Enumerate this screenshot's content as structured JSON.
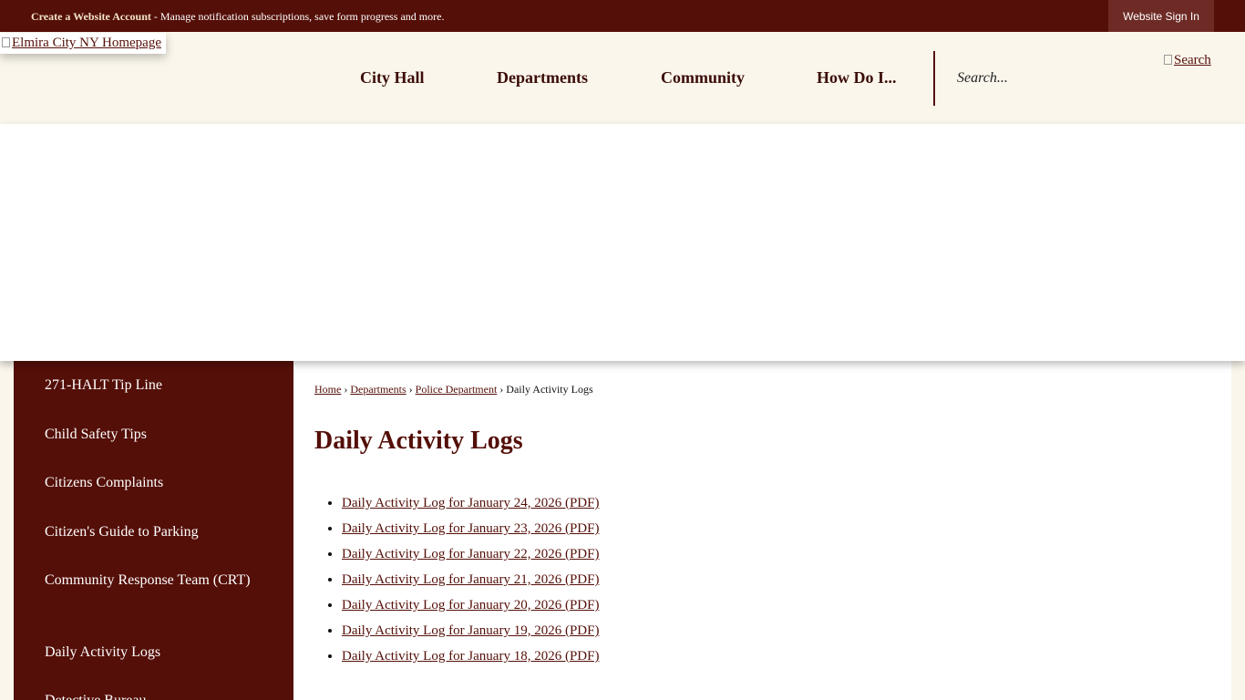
{
  "topbar": {
    "account_link": "Create a Website Account",
    "account_desc": " - Manage notification subscriptions, save form progress and more.",
    "signin_label": "Website Sign In"
  },
  "header": {
    "logo_alt": "Elmira City NY Homepage",
    "nav": [
      "City Hall",
      "Departments",
      "Community",
      "How Do I..."
    ],
    "search_placeholder": "Search...",
    "search_button_alt": "Search"
  },
  "sidebar": {
    "items": [
      "271-HALT Tip Line",
      "Child Safety Tips",
      "Citizens Complaints",
      "Citizen's Guide to Parking",
      "Community Response Team (CRT)",
      "Daily Activity Logs",
      "Detective Bureau"
    ]
  },
  "breadcrumb": {
    "items": [
      "Home",
      "Departments",
      "Police Department"
    ],
    "separator": "›",
    "current": "Daily Activity Logs"
  },
  "main": {
    "title": "Daily Activity Logs",
    "logs": [
      "Daily Activity Log for January 24, 2026 (PDF)",
      "Daily Activity Log for January 23, 2026 (PDF)",
      "Daily Activity Log for January 22, 2026 (PDF)",
      "Daily Activity Log for January 21, 2026 (PDF)",
      "Daily Activity Log for January 20, 2026 (PDF)",
      "Daily Activity Log for January 19, 2026 (PDF)",
      "Daily Activity Log for January 18, 2026 (PDF)"
    ]
  },
  "colors": {
    "brand_maroon": "#540f08",
    "signin_bg": "#6e2b25",
    "header_bg": "#faf6ec"
  }
}
